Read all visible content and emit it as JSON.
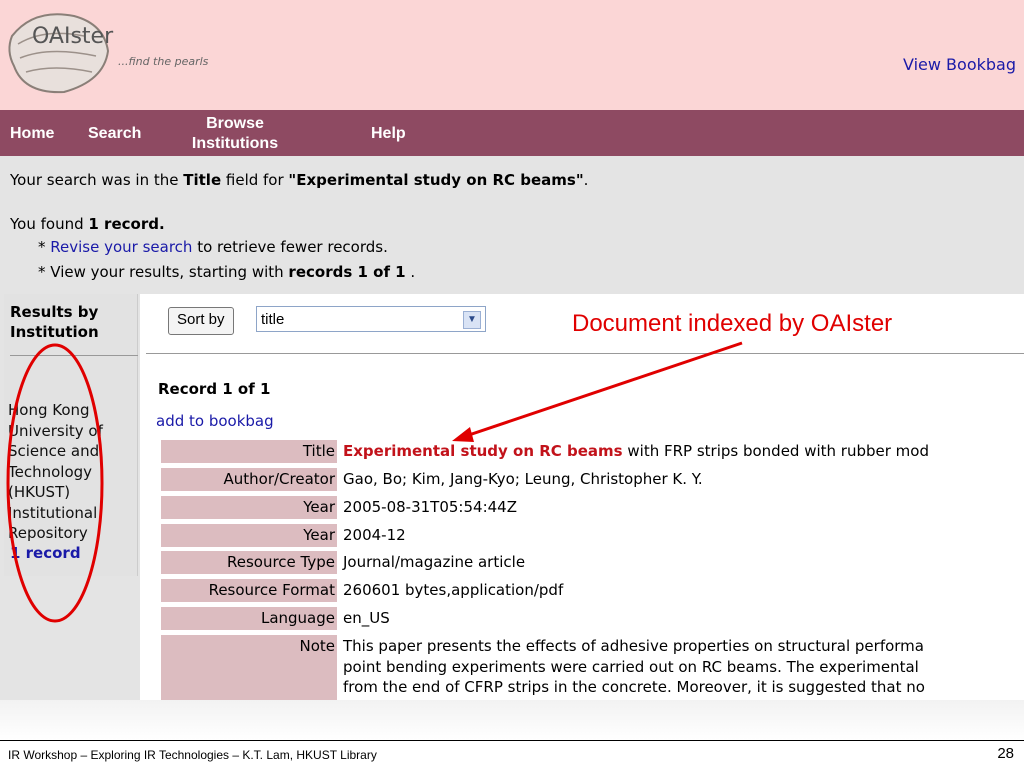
{
  "header": {
    "logo_text": "OAIster",
    "tagline": "...find the pearls",
    "bookbag_link": "View Bookbag"
  },
  "nav": {
    "home": "Home",
    "search": "Search",
    "browse_line1": "Browse",
    "browse_line2": "Institutions",
    "help": "Help"
  },
  "summary": {
    "line1_prefix": "Your search was in the ",
    "line1_field": "Title",
    "line1_mid": " field for ",
    "line1_query": "\"Experimental study on RC beams\"",
    "line1_end": ".",
    "line2_prefix": "You found ",
    "line2_count": "1 record.",
    "bullet1_star": "*",
    "bullet1_link": "Revise your search",
    "bullet1_rest": " to retrieve fewer records.",
    "bullet2_prefix": "* View your results, starting with ",
    "bullet2_bold": "records 1 of 1",
    "bullet2_end": " ."
  },
  "sidebar": {
    "title_line1": "Results by",
    "title_line2": "Institution",
    "institution_lines": [
      "Hong Kong",
      "University of",
      "Science and",
      "Technology",
      "(HKUST)",
      "Institutional",
      "Repository"
    ],
    "record_count": "1 record"
  },
  "sort": {
    "button_label": "Sort by",
    "selected": "title"
  },
  "annotation": {
    "text": "Document indexed by OAIster",
    "color": "#e00000"
  },
  "record": {
    "heading": "Record 1 of 1",
    "add_to_bookbag": "add to bookbag",
    "fields": [
      {
        "label": "Title",
        "value_highlight": "Experimental study on RC beams",
        "value": " with FRP strips bonded with rubber mod"
      },
      {
        "label": "Author/Creator",
        "value": "Gao, Bo; Kim, Jang-Kyo; Leung, Christopher K. Y."
      },
      {
        "label": "Year",
        "value": "2005-08-31T05:54:44Z"
      },
      {
        "label": "Year",
        "value": "2004-12"
      },
      {
        "label": "Resource Type",
        "value": "Journal/magazine article"
      },
      {
        "label": "Resource Format",
        "value": "260601 bytes,application/pdf"
      },
      {
        "label": "Language",
        "value": "en_US"
      },
      {
        "label": "Note",
        "value_lines": [
          "This paper presents the effects of adhesive properties on structural performa",
          "point bending experiments were carried out on RC beams. The experimental",
          "from the end of CFRP strips in the concrete. Moreover, it is suggested that no"
        ]
      }
    ]
  },
  "footer": {
    "text": "IR Workshop – Exploring IR Technologies – K.T. Lam, HKUST Library",
    "page_number": "28"
  },
  "colors": {
    "header_bg": "#fbd6d6",
    "nav_bg": "#8e4a62",
    "label_bg": "#dcbcc0",
    "link": "#1a1aa8",
    "title_highlight": "#c2121a"
  }
}
